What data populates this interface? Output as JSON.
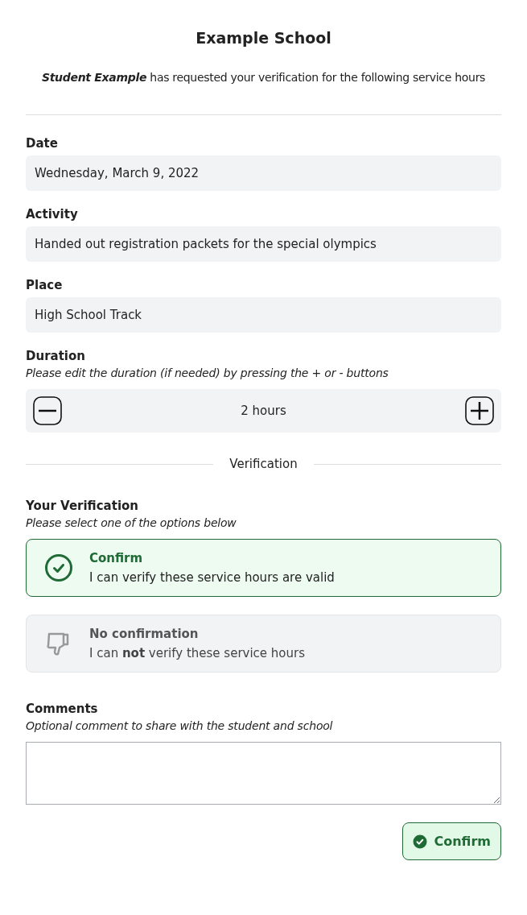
{
  "header": {
    "title": "Example School",
    "subtitle": "**Student Example** has requested your verification for the following service hours"
  },
  "fields": [
    {
      "label": "Date",
      "value": "Wednesday, March 9, 2022"
    },
    {
      "label": "Activity",
      "value": "Handed out registration packets for the special olympics"
    },
    {
      "label": "Place",
      "value": "High School Track"
    }
  ],
  "duration": {
    "label": "Duration",
    "hint": "Please edit the duration (if needed) by pressing the + or - buttons",
    "value": "2 hours"
  },
  "section_divider": "Verification",
  "verification": {
    "label": "Your Verification",
    "hint": "Please select one of the options below",
    "options": [
      {
        "kind": "confirm",
        "title": "Confirm",
        "description": "I can verify these service hours are valid",
        "selected": true
      },
      {
        "kind": "decline",
        "title": "No confirmation",
        "description": "I can **not** verify these service hours",
        "selected": false
      }
    ]
  },
  "comments": {
    "label": "Comments",
    "hint": "Optional comment to share with the student and school"
  },
  "submit_button": "Confirm"
}
